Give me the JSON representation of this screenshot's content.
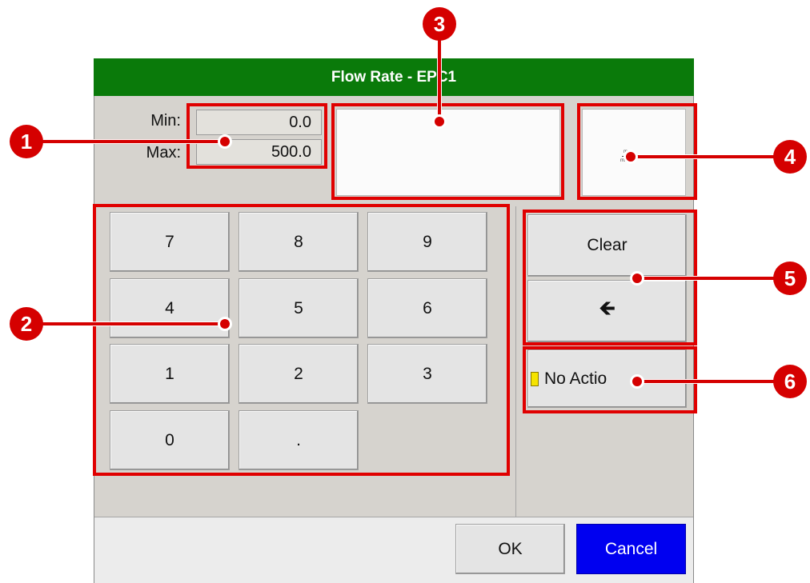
{
  "dialog": {
    "title": "Flow Rate - EPC1",
    "min_label": "Min:",
    "min_value": "0.0",
    "max_label": "Max:",
    "max_value": "500.0",
    "entry_value": "",
    "units_top": "m",
    "units_bottom": "mi"
  },
  "keypad": {
    "keys": [
      "7",
      "8",
      "9",
      "4",
      "5",
      "6",
      "1",
      "2",
      "3",
      "0",
      "."
    ]
  },
  "side_buttons": {
    "clear_label": "Clear",
    "backspace_glyph": "🡸",
    "action_label": "No Actio"
  },
  "footer": {
    "ok_label": "OK",
    "cancel_label": "Cancel"
  },
  "callouts": [
    "1",
    "2",
    "3",
    "4",
    "5",
    "6"
  ],
  "colors": {
    "title_bar": "#0a7a0a",
    "cancel_button": "#0000f0",
    "callout_red": "#d50000",
    "action_indicator": "#f5e300"
  }
}
